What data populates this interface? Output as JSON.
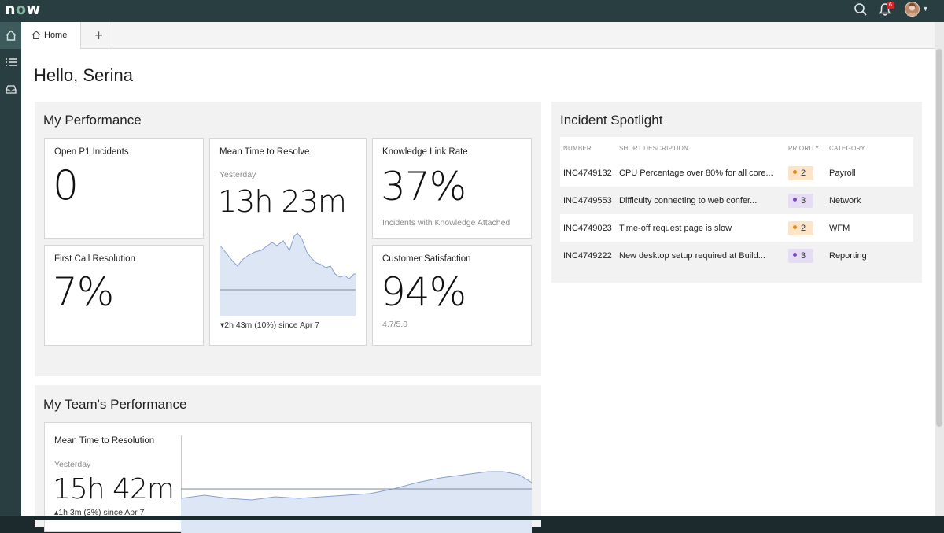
{
  "topbar": {
    "logo_prefix": "n",
    "logo_o": "o",
    "logo_suffix": "w",
    "notification_count": "6",
    "icons": [
      "search-icon",
      "bell-icon",
      "avatar"
    ]
  },
  "rail": [
    "home-icon",
    "list-icon",
    "inbox-icon"
  ],
  "tabs": {
    "home_label": "Home",
    "add_label": "+"
  },
  "greeting": "Hello, Serina",
  "my_performance": {
    "title": "My Performance",
    "open_p1": {
      "label": "Open P1 Incidents",
      "value": "0"
    },
    "mttr": {
      "label": "Mean Time to Resolve",
      "sub": "Yesterday",
      "value": "13h 23m",
      "trend": "▾2h 43m (10%) since Apr 7"
    },
    "knowledge": {
      "label": "Knowledge Link Rate",
      "value": "37%",
      "foot": "Incidents with Knowledge Attached"
    },
    "fcr": {
      "label": "First Call Resolution",
      "value": "7%"
    },
    "csat": {
      "label": "Customer Satisfaction",
      "value": "94%",
      "foot": "4.7/5.0"
    }
  },
  "incident_spotlight": {
    "title": "Incident Spotlight",
    "columns": [
      "NUMBER",
      "SHORT DESCRIPTION",
      "PRIORITY",
      "CATEGORY"
    ],
    "rows": [
      {
        "number": "INC4749132",
        "desc": "CPU Percentage over 80% for all core...",
        "priority": "2",
        "category": "Payroll"
      },
      {
        "number": "INC4749553",
        "desc": "Difficulty connecting to web confer...",
        "priority": "3",
        "category": "Network"
      },
      {
        "number": "INC4749023",
        "desc": "Time-off request page is slow",
        "priority": "2",
        "category": "WFM"
      },
      {
        "number": "INC4749222",
        "desc": "New desktop setup required at Build...",
        "priority": "3",
        "category": "Reporting"
      }
    ],
    "priority_colors": {
      "2": {
        "bg": "#fbe4c8",
        "dot": "#e08a1e"
      },
      "3": {
        "bg": "#e6ddf4",
        "dot": "#7a4bbf"
      }
    }
  },
  "team_performance": {
    "title": "My Team's Performance",
    "label": "Mean Time to Resolution",
    "sub": "Yesterday",
    "value": "15h 42m",
    "trend": "▴1h 3m (3%) since Apr 7"
  },
  "colors": {
    "accent": "#293e40",
    "chart_fill": "#dde6f5",
    "chart_line": "#8a9fd0"
  }
}
